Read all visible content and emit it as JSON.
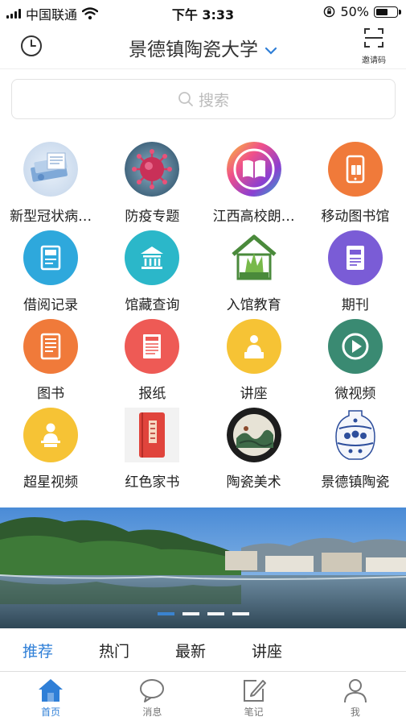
{
  "status_bar": {
    "carrier": "中国联通",
    "time": "下午 3:33",
    "battery": "50%"
  },
  "header": {
    "title": "景德镇陶瓷大学",
    "invite_label": "邀请码"
  },
  "search": {
    "placeholder": "搜索"
  },
  "grid": [
    {
      "label": "新型冠状病…",
      "icon": "covid-report-icon"
    },
    {
      "label": "防疫专题",
      "icon": "virus-icon"
    },
    {
      "label": "江西高校朗…",
      "icon": "book-reading-icon"
    },
    {
      "label": "移动图书馆",
      "icon": "mobile-library-icon"
    },
    {
      "label": "借阅记录",
      "icon": "borrow-record-icon"
    },
    {
      "label": "馆藏查询",
      "icon": "library-building-icon"
    },
    {
      "label": "入馆教育",
      "icon": "house-hand-icon"
    },
    {
      "label": "期刊",
      "icon": "journal-icon"
    },
    {
      "label": "图书",
      "icon": "book-icon"
    },
    {
      "label": "报纸",
      "icon": "newspaper-icon"
    },
    {
      "label": "讲座",
      "icon": "lecture-icon"
    },
    {
      "label": "微视频",
      "icon": "play-icon"
    },
    {
      "label": "超星视频",
      "icon": "presenter-icon"
    },
    {
      "label": "红色家书",
      "icon": "red-letter-book-icon"
    },
    {
      "label": "陶瓷美术",
      "icon": "ceramic-art-icon"
    },
    {
      "label": "景德镇陶瓷",
      "icon": "porcelain-vase-icon"
    }
  ],
  "banner": {
    "slides": 4,
    "active_slide": 1
  },
  "tabs": [
    "推荐",
    "热门",
    "最新",
    "讲座"
  ],
  "bottom_nav": [
    "首页",
    "消息",
    "笔记",
    "我"
  ],
  "colors": {
    "accent": "#2f7fd7",
    "orange": "#f07a3a",
    "teal": "#2bb0c8",
    "purple": "#7a5cd6",
    "yellow": "#f6c335",
    "red": "#ee5a55",
    "green": "#3a8a72"
  }
}
